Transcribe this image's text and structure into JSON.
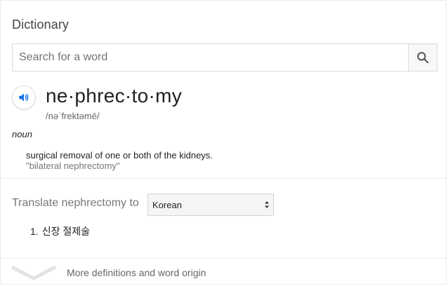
{
  "panel": {
    "title": "Dictionary"
  },
  "search": {
    "placeholder": "Search for a word",
    "value": "",
    "button_icon": "search-icon"
  },
  "entry": {
    "audio_icon": "speaker-icon",
    "headword": "ne·phrec·to·my",
    "pronunciation": "/nəˈfrektəmē/",
    "part_of_speech": "noun",
    "definition": "surgical removal of one or both of the kidneys.",
    "example": "\"bilateral nephrectomy\""
  },
  "translate": {
    "label": "Translate nephrectomy to",
    "selected_language": "Korean",
    "results": [
      {
        "number": "1.",
        "text": "신장 절제술"
      }
    ]
  },
  "footer": {
    "expand_icon": "chevron-down-icon",
    "more_label": "More definitions and word origin"
  },
  "colors": {
    "accent": "#4285f4",
    "border": "#d9d9d9",
    "muted_text": "#777777"
  }
}
